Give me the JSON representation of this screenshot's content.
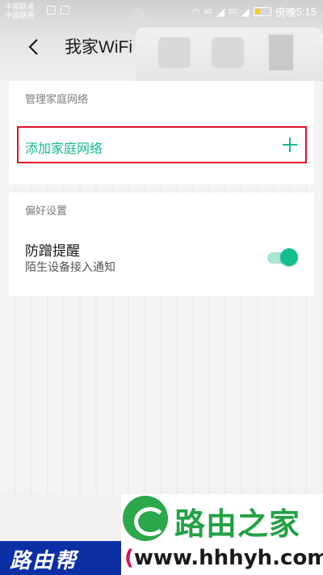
{
  "status_bar": {
    "carrier_1": "中国联通",
    "carrier_2": "中国联通",
    "network_1": "4G",
    "network_2": "2G",
    "time_prefix": "傍晚",
    "time": "5:15"
  },
  "header": {
    "back_icon": "chevron-left-icon",
    "title": "我家WiFi"
  },
  "home_network": {
    "section_label": "管理家庭网络",
    "add_label": "添加家庭网络",
    "add_icon": "plus-icon",
    "accent_color": "#14b88e",
    "highlight_color": "#e0142a"
  },
  "preferences": {
    "section_label": "偏好设置",
    "item_title": "防蹭提醒",
    "item_subtitle": "陌生设备接入通知",
    "toggle_state": "on",
    "toggle_color": "#12c08f"
  },
  "watermark": {
    "logo_text": "路由之家",
    "left_text": "路由帮",
    "url_text": "www.hhhyh.com",
    "paren": "("
  }
}
